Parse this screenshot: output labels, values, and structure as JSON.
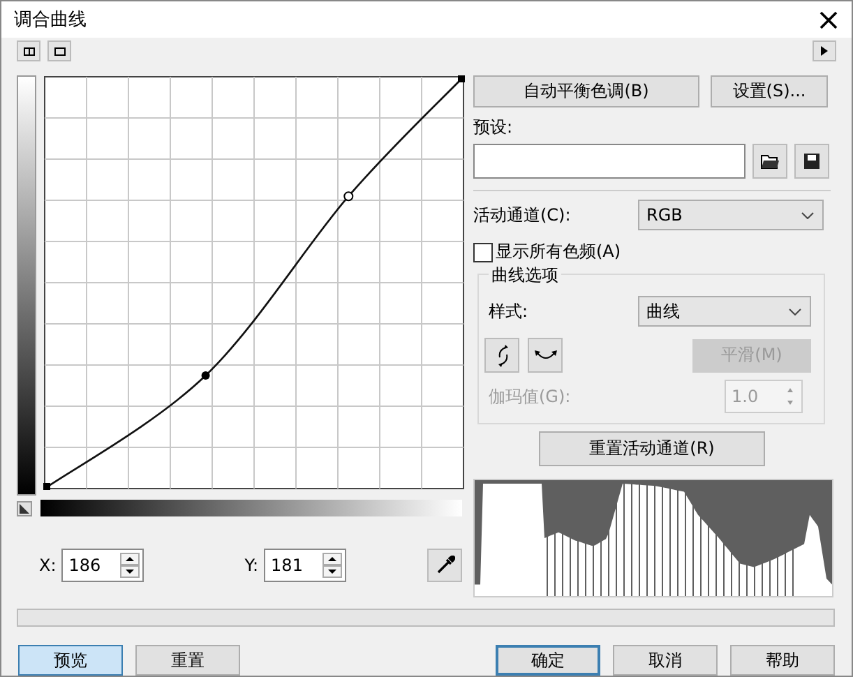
{
  "window": {
    "title": "调合曲线"
  },
  "auto_balance_button": "自动平衡色调(B)",
  "settings_button": "设置(S)...",
  "preset": {
    "label": "预设:"
  },
  "channel": {
    "label": "活动通道(C):",
    "value": "RGB"
  },
  "show_all": {
    "label": "显示所有色频(A)",
    "checked": false
  },
  "curve_options": {
    "title": "曲线选项",
    "style_label": "样式:",
    "style_value": "曲线",
    "smooth_button": {
      "label": "平滑(M)",
      "disabled": true
    },
    "gamma": {
      "label": "伽玛值(G):",
      "value": "1.0",
      "disabled": true
    }
  },
  "reset_channel_button": "重置活动通道(R)",
  "x_field": {
    "label": "X:",
    "value": "186"
  },
  "y_field": {
    "label": "Y:",
    "value": "181"
  },
  "progress": {
    "level": 0
  },
  "footer_buttons": [
    {
      "label": "预览",
      "selected": true,
      "default": false
    },
    {
      "label": "重置",
      "selected": false,
      "default": false
    },
    {
      "label": "确定",
      "selected": false,
      "default": true
    },
    {
      "label": "取消",
      "selected": false,
      "default": false
    },
    {
      "label": "帮助",
      "selected": false,
      "default": false
    }
  ]
}
